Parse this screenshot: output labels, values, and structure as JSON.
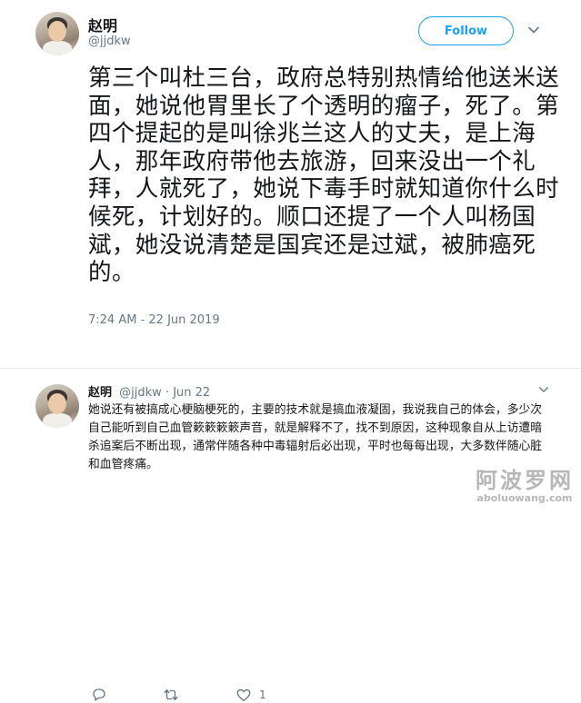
{
  "tweet": {
    "author_name": "赵明",
    "handle": "@jjdkw",
    "follow_label": "Follow",
    "text": "第三个叫杜三台，政府总特别热情给他送米送面，她说他胃里长了个透明的瘤子，死了。第四个提起的是叫徐兆兰这人的丈夫，是上海人，那年政府带他去旅游，回来没出一个礼拜，人就死了，她说下毒手时就知道你什么时候死，计划好的。顺口还提了一个人叫杨国斌，她没说清楚是国宾还是过斌，被肺癌死的。",
    "timestamp": "7:24 AM - 22 Jun 2019",
    "actions": {
      "reply_count": "",
      "retweet_count": "",
      "like_count": "1"
    }
  },
  "reply": {
    "author_name": "赵明",
    "handle": "@jjdkw",
    "date": "· Jun 22",
    "text": "她说还有被搞成心梗脑梗死的，主要的技术就是搞血液凝固，我说我自己的体会，多少次自己能听到自己血管簌簌簌簌声音，就是解释不了，找不到原因，这种现象自从上访遭暗杀追案后不断出现，通常伴随各种中毒辐射后必出现，平时也每每出现，大多数伴随心脏和血管疼痛。"
  },
  "watermark": {
    "name": "阿波罗网",
    "url": "aboluowang.com"
  },
  "colors": {
    "accent": "#1da1f2",
    "secondary_text": "#657786",
    "primary_text": "#14171a"
  },
  "icons": [
    "reply-icon",
    "retweet-icon",
    "like-icon",
    "chevron-down-icon"
  ]
}
